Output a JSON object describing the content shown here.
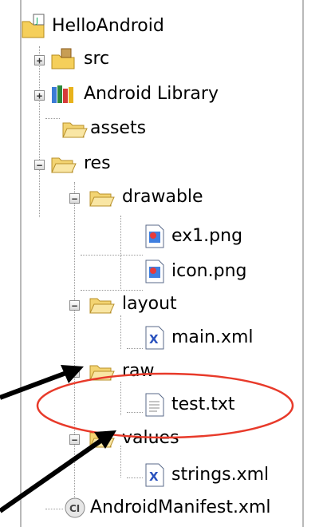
{
  "tree": {
    "project": "HelloAndroid",
    "src": "src",
    "android_library": "Android Library",
    "assets": "assets",
    "res": "res",
    "drawable": "drawable",
    "ex1": "ex1.png",
    "icon_png": "icon.png",
    "layout": "layout",
    "main_xml": "main.xml",
    "raw": "raw",
    "test_txt": "test.txt",
    "values": "values",
    "strings_xml": "strings.xml",
    "manifest": "AndroidManifest.xml"
  },
  "annotation": {
    "highlight_color": "#e83a2a",
    "arrow_color": "#000000"
  }
}
